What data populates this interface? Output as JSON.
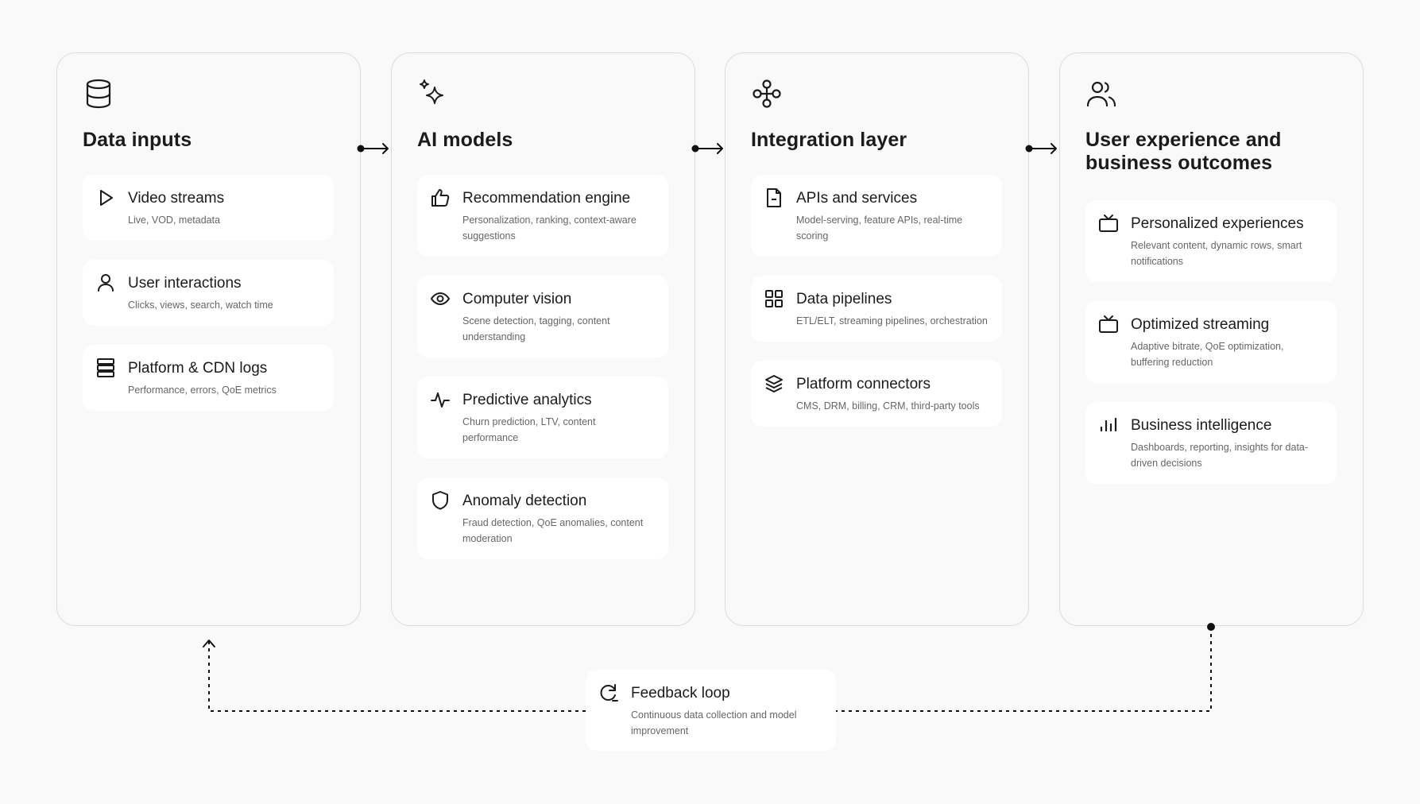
{
  "columns": [
    {
      "title": "Data inputs",
      "icon": "database-icon",
      "cards": [
        {
          "icon": "play-icon",
          "title": "Video streams",
          "desc": "Live, VOD, metadata"
        },
        {
          "icon": "user-icon",
          "title": "User interactions",
          "desc": "Clicks, views, search, watch time"
        },
        {
          "icon": "server-icon",
          "title": "Platform & CDN logs",
          "desc": "Performance, errors, QoE metrics"
        }
      ]
    },
    {
      "title": "AI models",
      "icon": "sparkles-icon",
      "cards": [
        {
          "icon": "thumbs-up-icon",
          "title": "Recommendation engine",
          "desc": "Personalization, ranking, context-aware suggestions"
        },
        {
          "icon": "eye-icon",
          "title": "Computer vision",
          "desc": "Scene detection, tagging, content understanding"
        },
        {
          "icon": "activity-icon",
          "title": "Predictive analytics",
          "desc": "Churn prediction, LTV, content performance"
        },
        {
          "icon": "shield-icon",
          "title": "Anomaly detection",
          "desc": "Fraud detection, QoE anomalies, content moderation"
        }
      ]
    },
    {
      "title": "Integration layer",
      "icon": "workflow-icon",
      "cards": [
        {
          "icon": "file-icon",
          "title": "APIs and services",
          "desc": "Model-serving, feature APIs, real-time scoring"
        },
        {
          "icon": "grid-icon",
          "title": "Data pipelines",
          "desc": "ETL/ELT, streaming pipelines, orchestration"
        },
        {
          "icon": "layers-icon",
          "title": "Platform connectors",
          "desc": "CMS, DRM, billing, CRM, third-party tools"
        }
      ]
    },
    {
      "title": "User experience and business outcomes",
      "icon": "users-icon",
      "cards": [
        {
          "icon": "tv-icon",
          "title": "Personalized experiences",
          "desc": "Relevant content, dynamic rows, smart notifications"
        },
        {
          "icon": "tv-icon",
          "title": "Optimized streaming",
          "desc": "Adaptive bitrate, QoE optimization, buffering reduction"
        },
        {
          "icon": "bar-chart-icon",
          "title": "Business intelligence",
          "desc": "Dashboards, reporting, insights for data-driven decisions"
        }
      ]
    }
  ],
  "feedback": {
    "icon": "refresh-icon",
    "title": "Feedback loop",
    "desc": "Continuous data collection and model improvement"
  }
}
